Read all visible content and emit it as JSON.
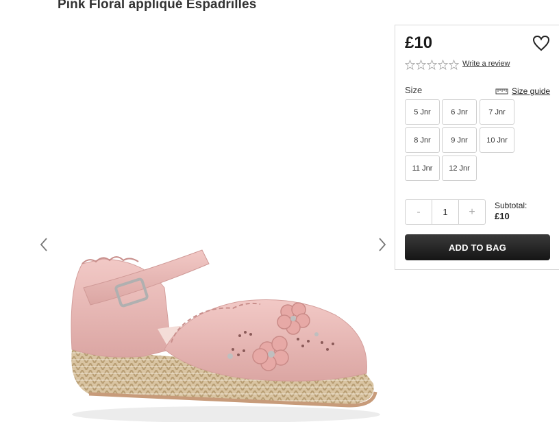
{
  "product": {
    "title": "Pink Floral appliqué Espadrilles",
    "price": "£10",
    "review_link": "Write a review",
    "rating_stars": 5
  },
  "sizes": {
    "label": "Size",
    "guide_label": "Size guide",
    "options": [
      "5 Jnr",
      "6 Jnr",
      "7 Jnr",
      "8 Jnr",
      "9 Jnr",
      "10 Jnr",
      "11 Jnr",
      "12 Jnr"
    ]
  },
  "quantity": {
    "minus": "-",
    "value": "1",
    "plus": "+"
  },
  "subtotal": {
    "label": "Subtotal:",
    "amount": "£10"
  },
  "cta": {
    "add_to_bag": "ADD TO BAG"
  },
  "gallery": {
    "prev_icon": "chevron-left-icon",
    "next_icon": "chevron-right-icon"
  },
  "colors": {
    "button_dark": "#1f1f1f",
    "shoe_pink": "#e8b6b4",
    "border": "#cfcfcf"
  }
}
